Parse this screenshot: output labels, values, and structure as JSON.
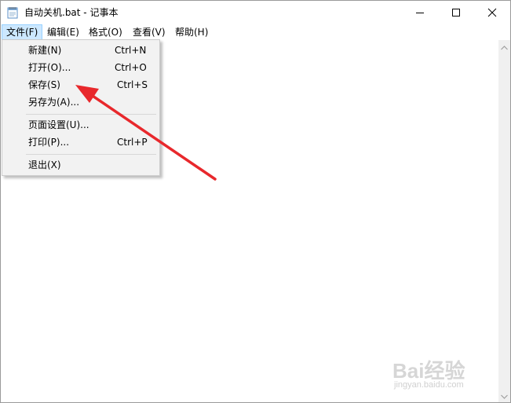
{
  "window": {
    "title": "自动关机.bat - 记事本",
    "icon": "notepad-icon",
    "controls": [
      "minimize-icon",
      "maximize-icon",
      "close-icon"
    ]
  },
  "menubar": {
    "items": [
      {
        "label": "文件(F)",
        "active": true
      },
      {
        "label": "编辑(E)",
        "active": false
      },
      {
        "label": "格式(O)",
        "active": false
      },
      {
        "label": "查看(V)",
        "active": false
      },
      {
        "label": "帮助(H)",
        "active": false
      }
    ]
  },
  "file_menu": {
    "items": [
      {
        "label": "新建(N)",
        "shortcut": "Ctrl+N"
      },
      {
        "label": "打开(O)...",
        "shortcut": "Ctrl+O"
      },
      {
        "label": "保存(S)",
        "shortcut": "Ctrl+S"
      },
      {
        "label": "另存为(A)...",
        "shortcut": ""
      },
      {
        "label": "页面设置(U)...",
        "shortcut": ""
      },
      {
        "label": "打印(P)...",
        "shortcut": "Ctrl+P"
      },
      {
        "label": "退出(X)",
        "shortcut": ""
      }
    ]
  },
  "editor": {
    "content": ""
  },
  "annotation": {
    "arrow_color": "#e8282c",
    "points_to": "保存(S)"
  },
  "watermark": {
    "logo": "Bai经验",
    "url": "jingyan.baidu.com"
  },
  "colors": {
    "menu_active_bg": "#cce8ff",
    "menu_active_border": "#99d1ff",
    "dropdown_bg": "#f2f2f2"
  }
}
